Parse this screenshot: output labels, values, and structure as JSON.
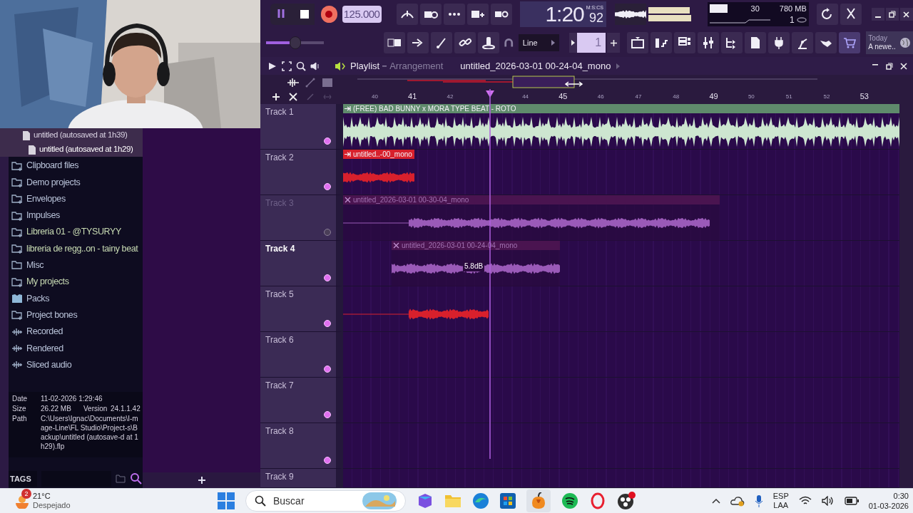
{
  "toolbar": {
    "tempo": "125.000",
    "time": "1:20",
    "time_cs": "92",
    "time_unit": "M:S:CS",
    "cpu": "30",
    "memory": "780 MB",
    "voices": "1",
    "snap": "Line",
    "pattern": "1",
    "pitch": {
      "level": 0.5
    },
    "news": {
      "title": "Today",
      "text": "A newe.."
    }
  },
  "playlist": {
    "title": "Playlist",
    "mode": "Arrangement",
    "file": "untitled_2026-03-01 00-24-04_mono",
    "ruler": [
      {
        "label": "40",
        "major": false
      },
      {
        "label": "41",
        "major": true
      },
      {
        "label": "42",
        "major": false
      },
      {
        "label": "44",
        "major": false
      },
      {
        "label": "45",
        "major": true
      },
      {
        "label": "46",
        "major": false
      },
      {
        "label": "47",
        "major": false
      },
      {
        "label": "48",
        "major": false
      },
      {
        "label": "49",
        "major": true
      },
      {
        "label": "50",
        "major": false
      },
      {
        "label": "51",
        "major": false
      },
      {
        "label": "52",
        "major": false
      },
      {
        "label": "53",
        "major": true
      }
    ],
    "tracks": [
      {
        "name": "Track 1",
        "muted": false,
        "selected": false,
        "clips": [
          {
            "kind": "beat",
            "title": "(FREE) BAD BUNNY x MORA TYPE BEAT - ROTO",
            "color": "#5f8a6c",
            "muted": false
          }
        ]
      },
      {
        "name": "Track 2",
        "muted": false,
        "selected": false,
        "clips": [
          {
            "kind": "vocal",
            "title": "untitled..-00_mono",
            "color": "#d8202c",
            "muted": false
          }
        ]
      },
      {
        "name": "Track 3",
        "muted": true,
        "selected": false,
        "clips": [
          {
            "kind": "vocal",
            "title": "untitled_2026-03-01 00-30-04_mono",
            "color": "#4a1450",
            "muted": true
          }
        ]
      },
      {
        "name": "Track 4",
        "muted": false,
        "selected": true,
        "clips": [
          {
            "kind": "vocal",
            "title": "untitled_2026-03-01 00-24-04_mono",
            "color": "#4a1450",
            "muted": true,
            "gain": "5.8dB"
          }
        ]
      },
      {
        "name": "Track 5",
        "muted": false,
        "selected": false,
        "clips": [
          {
            "kind": "vocal",
            "color": "#d8202c",
            "muted": false
          }
        ]
      },
      {
        "name": "Track 6",
        "muted": false,
        "selected": false
      },
      {
        "name": "Track 7",
        "muted": false,
        "selected": false
      },
      {
        "name": "Track 8",
        "muted": false,
        "selected": false
      },
      {
        "name": "Track 9",
        "muted": false,
        "selected": false
      }
    ]
  },
  "browser": {
    "files": [
      {
        "name": "untitled (autosaved at 1h39)",
        "selected": false
      },
      {
        "name": "untitled (autosaved at 1h29)",
        "selected": true
      }
    ],
    "folders": [
      {
        "name": "Clipboard files",
        "kind": "folder-plus",
        "color": "#b9c3d9"
      },
      {
        "name": "Demo projects",
        "kind": "folder-plus",
        "color": "#b9c3d9"
      },
      {
        "name": "Envelopes",
        "kind": "folder-plus",
        "color": "#b9c3d9"
      },
      {
        "name": "Impulses",
        "kind": "folder-plus",
        "color": "#b9c3d9"
      },
      {
        "name": "Libreria 01 - @TYSURYY",
        "kind": "folder-plus",
        "color": "#c9dcb4"
      },
      {
        "name": "libreria de regg..on - tainy beat",
        "kind": "folder-plus",
        "color": "#c9dcb4"
      },
      {
        "name": "Misc",
        "kind": "folder",
        "color": "#b9c3d9"
      },
      {
        "name": "My projects",
        "kind": "folder-plus",
        "color": "#c9dcb4"
      },
      {
        "name": "Packs",
        "kind": "pack",
        "color": "#b9c3d9"
      },
      {
        "name": "Project bones",
        "kind": "folder-plus",
        "color": "#b9c3d9"
      },
      {
        "name": "Recorded",
        "kind": "audio",
        "color": "#b9c3d9"
      },
      {
        "name": "Rendered",
        "kind": "audio",
        "color": "#b9c3d9"
      },
      {
        "name": "Sliced audio",
        "kind": "audio",
        "color": "#b9c3d9"
      }
    ],
    "info": [
      {
        "label": "Date",
        "value": "11-02-2026 1:29:46"
      },
      {
        "label": "Size",
        "value": "26.22 MB",
        "extra_label": "Version",
        "extra_value": "24.1.1.42"
      },
      {
        "label": "Path",
        "value": "C:\\Users\\Ignac\\Documents\\I-mage-Line\\FL Studio\\Project-s\\Backup\\untitled (autosave-d at 1h29).flp"
      }
    ],
    "tags": "TAGS"
  },
  "taskbar": {
    "weather": {
      "temp": "21°C",
      "text": "Despejado",
      "badge": "2"
    },
    "search": "Buscar",
    "language": "ESP",
    "layout": "LAA",
    "time": "0:30",
    "date": "01-03-2026"
  }
}
